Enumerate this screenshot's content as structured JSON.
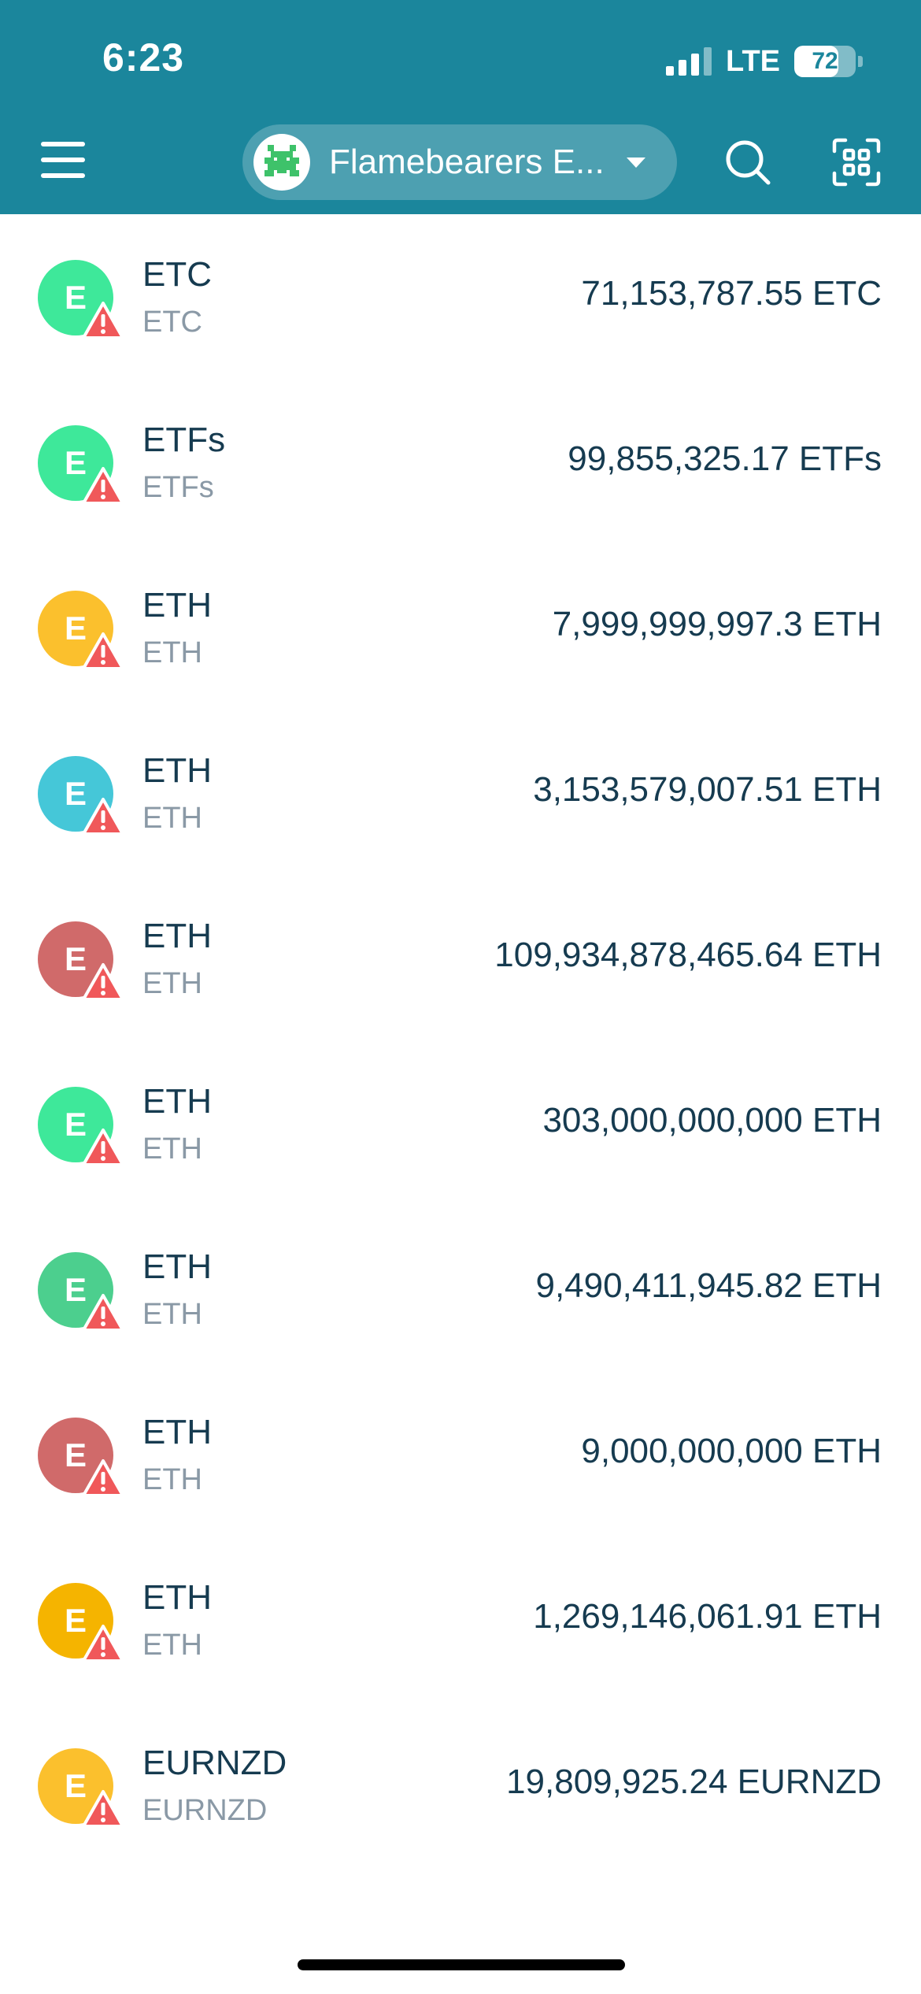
{
  "status_bar": {
    "time": "6:23",
    "network": "LTE",
    "battery": "72",
    "battery_fraction": 0.72
  },
  "header": {
    "menu_icon": "hamburger-menu-icon",
    "wallet_name": "Flamebearers E...",
    "wallet_avatar_icon": "pixel-invader-avatar-icon",
    "search_icon": "search-icon",
    "scan_icon": "qr-scan-icon"
  },
  "colors": {
    "header_bg": "#1b869c",
    "text_primary": "#163b50",
    "text_secondary": "#8a99a6",
    "warning": "#f0585a"
  },
  "tokens": [
    {
      "name": "ETC",
      "symbol": "ETC",
      "balance": "71,153,787.55 ETC",
      "icon_letter": "E",
      "icon_color": "#3ee89a"
    },
    {
      "name": "ETFs",
      "symbol": "ETFs",
      "balance": "99,855,325.17 ETFs",
      "icon_letter": "E",
      "icon_color": "#3ee89a"
    },
    {
      "name": "ETH",
      "symbol": "ETH",
      "balance": "7,999,999,997.3 ETH",
      "icon_letter": "E",
      "icon_color": "#fbc02d"
    },
    {
      "name": "ETH",
      "symbol": "ETH",
      "balance": "3,153,579,007.51 ETH",
      "icon_letter": "E",
      "icon_color": "#45c7d8"
    },
    {
      "name": "ETH",
      "symbol": "ETH",
      "balance": "109,934,878,465.64 ETH",
      "icon_letter": "E",
      "icon_color": "#d06a6a"
    },
    {
      "name": "ETH",
      "symbol": "ETH",
      "balance": "303,000,000,000 ETH",
      "icon_letter": "E",
      "icon_color": "#3ee89a"
    },
    {
      "name": "ETH",
      "symbol": "ETH",
      "balance": "9,490,411,945.82 ETH",
      "icon_letter": "E",
      "icon_color": "#4ccf8e"
    },
    {
      "name": "ETH",
      "symbol": "ETH",
      "balance": "9,000,000,000 ETH",
      "icon_letter": "E",
      "icon_color": "#d06a6a"
    },
    {
      "name": "ETH",
      "symbol": "ETH",
      "balance": "1,269,146,061.91 ETH",
      "icon_letter": "E",
      "icon_color": "#f5b400"
    },
    {
      "name": "EURNZD",
      "symbol": "EURNZD",
      "balance": "19,809,925.24 EURNZD",
      "icon_letter": "E",
      "icon_color": "#fbc02d"
    }
  ]
}
